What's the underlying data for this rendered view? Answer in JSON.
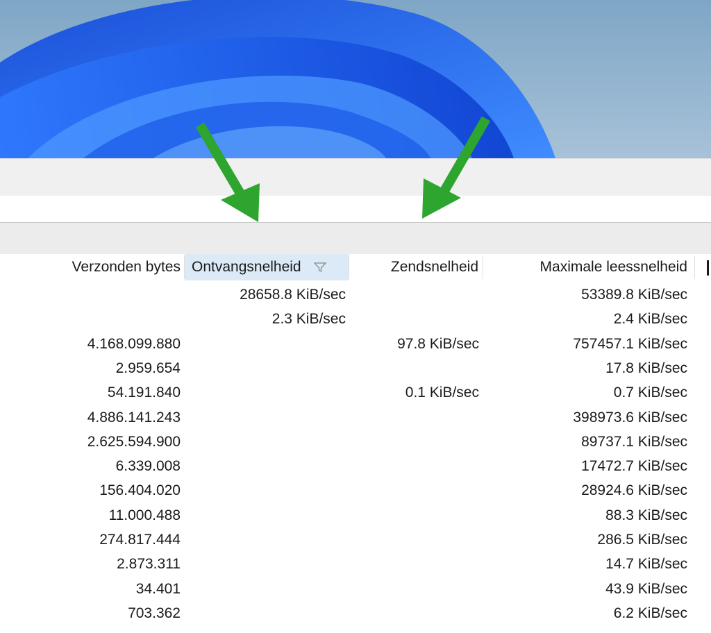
{
  "table": {
    "columns": [
      {
        "label": "Verzonden bytes"
      },
      {
        "label": "Ontvangsnelheid"
      },
      {
        "label": "Zendsnelheid"
      },
      {
        "label": "Maximale leessnelheid"
      }
    ],
    "rows": [
      {
        "verzonden": "",
        "ontvang": "28658.8 KiB/sec",
        "zend": "",
        "max": "53389.8 KiB/sec"
      },
      {
        "verzonden": "",
        "ontvang": "2.3 KiB/sec",
        "zend": "",
        "max": "2.4 KiB/sec"
      },
      {
        "verzonden": "4.168.099.880",
        "ontvang": "",
        "zend": "97.8 KiB/sec",
        "max": "757457.1 KiB/sec"
      },
      {
        "verzonden": "2.959.654",
        "ontvang": "",
        "zend": "",
        "max": "17.8 KiB/sec"
      },
      {
        "verzonden": "54.191.840",
        "ontvang": "",
        "zend": "0.1 KiB/sec",
        "max": "0.7 KiB/sec"
      },
      {
        "verzonden": "4.886.141.243",
        "ontvang": "",
        "zend": "",
        "max": "398973.6 KiB/sec"
      },
      {
        "verzonden": "2.625.594.900",
        "ontvang": "",
        "zend": "",
        "max": "89737.1 KiB/sec"
      },
      {
        "verzonden": "6.339.008",
        "ontvang": "",
        "zend": "",
        "max": "17472.7 KiB/sec"
      },
      {
        "verzonden": "156.404.020",
        "ontvang": "",
        "zend": "",
        "max": "28924.6 KiB/sec"
      },
      {
        "verzonden": "11.000.488",
        "ontvang": "",
        "zend": "",
        "max": "88.3 KiB/sec"
      },
      {
        "verzonden": "274.817.444",
        "ontvang": "",
        "zend": "",
        "max": "286.5 KiB/sec"
      },
      {
        "verzonden": "2.873.311",
        "ontvang": "",
        "zend": "",
        "max": "14.7 KiB/sec"
      },
      {
        "verzonden": "34.401",
        "ontvang": "",
        "zend": "",
        "max": "43.9 KiB/sec"
      },
      {
        "verzonden": "703.362",
        "ontvang": "",
        "zend": "",
        "max": "6.2 KiB/sec"
      }
    ]
  },
  "colors": {
    "annotation_arrow": "#2ea52e",
    "sorted_header_bg": "#dceaf7",
    "wallpaper_bloom": "#1f5fe0"
  },
  "icons": {
    "sort_filter": "filter-icon",
    "annotation": "green-arrow-icon"
  }
}
